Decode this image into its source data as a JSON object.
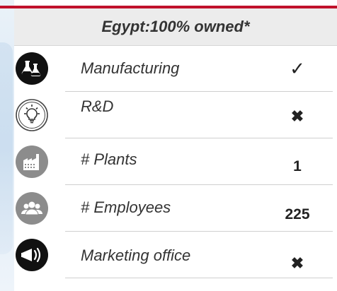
{
  "header": {
    "title": "Egypt:100% owned*"
  },
  "rows": [
    {
      "icon": "lab-flasks-icon",
      "label": "Manufacturing",
      "value": "✓"
    },
    {
      "icon": "lightbulb-icon",
      "label": "R&D",
      "value": "✖"
    },
    {
      "icon": "factory-icon",
      "label": "# Plants",
      "value": "1"
    },
    {
      "icon": "people-group-icon",
      "label": "# Employees",
      "value": "225"
    },
    {
      "icon": "megaphone-icon",
      "label": "Marketing office",
      "value": "✖"
    }
  ],
  "colors": {
    "accent_rule": "#c0112b",
    "header_bg": "#ececec",
    "icon_dark": "#111111",
    "icon_gray": "#8c8c8c"
  }
}
